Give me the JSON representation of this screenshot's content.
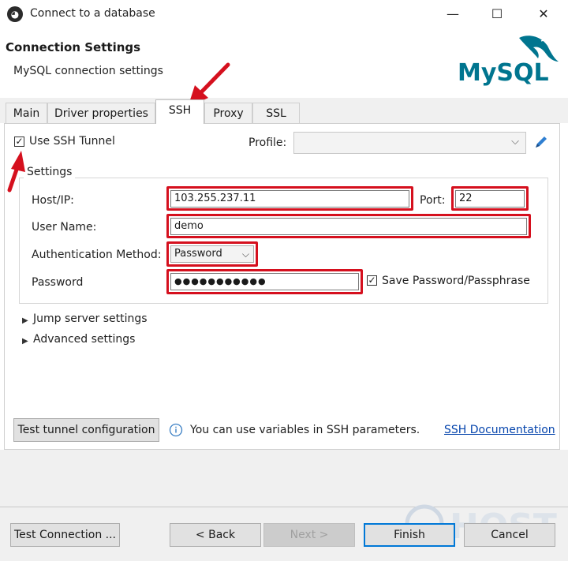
{
  "window": {
    "title": "Connect to a database",
    "minimize": "—",
    "maximize": "☐",
    "close": "✕"
  },
  "header": {
    "title": "Connection Settings",
    "subtitle": "MySQL connection settings",
    "logo_text": "MySQL"
  },
  "tabs": [
    {
      "label": "Main"
    },
    {
      "label": "Driver properties"
    },
    {
      "label": "SSH"
    },
    {
      "label": "Proxy"
    },
    {
      "label": "SSL"
    }
  ],
  "active_tab": "SSH",
  "ssh": {
    "use_tunnel_label": "Use SSH Tunnel",
    "use_tunnel_checked": true,
    "profile_label": "Profile:",
    "profile_value": "",
    "settings_legend": "Settings",
    "host_label": "Host/IP:",
    "host_value": "103.255.237.11",
    "port_label": "Port:",
    "port_value": "22",
    "user_label": "User Name:",
    "user_value": "demo",
    "auth_label": "Authentication Method:",
    "auth_value": "Password",
    "password_label": "Password",
    "password_value": "●●●●●●●●●●●",
    "save_password_label": "Save Password/Passphrase",
    "save_password_checked": true,
    "jump_server_label": "Jump server settings",
    "advanced_label": "Advanced settings",
    "test_tunnel_label": "Test tunnel configuration",
    "info_text": "You can use variables in SSH parameters.",
    "doc_link": "SSH Documentation"
  },
  "footer": {
    "test_connection": "Test Connection ...",
    "back": "< Back",
    "next": "Next >",
    "finish": "Finish",
    "cancel": "Cancel"
  },
  "watermark": "HOST",
  "colors": {
    "annotation_red": "#d5101e",
    "link_blue": "#0645ad",
    "mysql_blue": "#00758f",
    "mysql_orange": "#f29111"
  }
}
